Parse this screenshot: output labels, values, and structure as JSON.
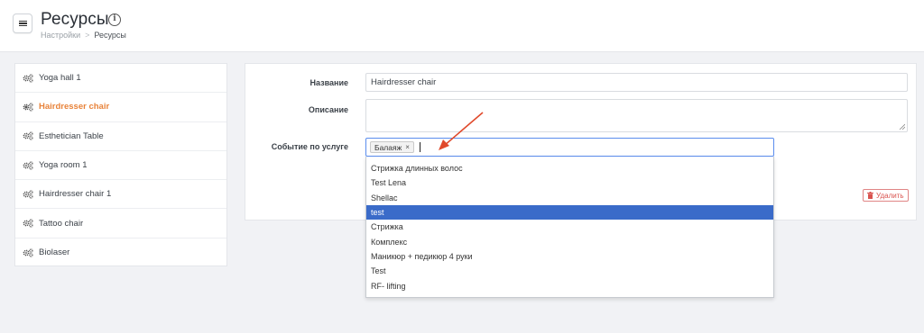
{
  "header": {
    "title": "Ресурсы",
    "breadcrumb": {
      "parent": "Настройки",
      "separator": ">",
      "current": "Ресурсы"
    }
  },
  "sidebar": {
    "items": [
      {
        "label": "Yoga hall 1",
        "active": false
      },
      {
        "label": "Hairdresser chair",
        "active": true
      },
      {
        "label": "Esthetician Table",
        "active": false
      },
      {
        "label": "Yoga room 1",
        "active": false
      },
      {
        "label": "Hairdresser chair 1",
        "active": false
      },
      {
        "label": "Tattoo chair",
        "active": false
      },
      {
        "label": "Biolaser",
        "active": false
      }
    ]
  },
  "form": {
    "name_label": "Название",
    "name_value": "Hairdresser chair",
    "description_label": "Описание",
    "description_value": "",
    "service_event_label": "Событие по услуге",
    "selected_tags": [
      {
        "label": "Балаяж",
        "remove": "×"
      }
    ],
    "delete_label": "Удалить"
  },
  "dropdown": {
    "highlighted_index": 3,
    "options": [
      "Стрижка длинных волос",
      "Test Lena",
      "Shellac",
      "test",
      "Стрижка",
      "Комплекс",
      "Маникюр + педикюр 4 руки",
      "Test",
      "RF- lifting"
    ]
  },
  "colors": {
    "accent_active": "#e8833a",
    "highlight": "#3a6bc9",
    "delete": "#d9534f",
    "annotation_arrow": "#e0492b"
  }
}
